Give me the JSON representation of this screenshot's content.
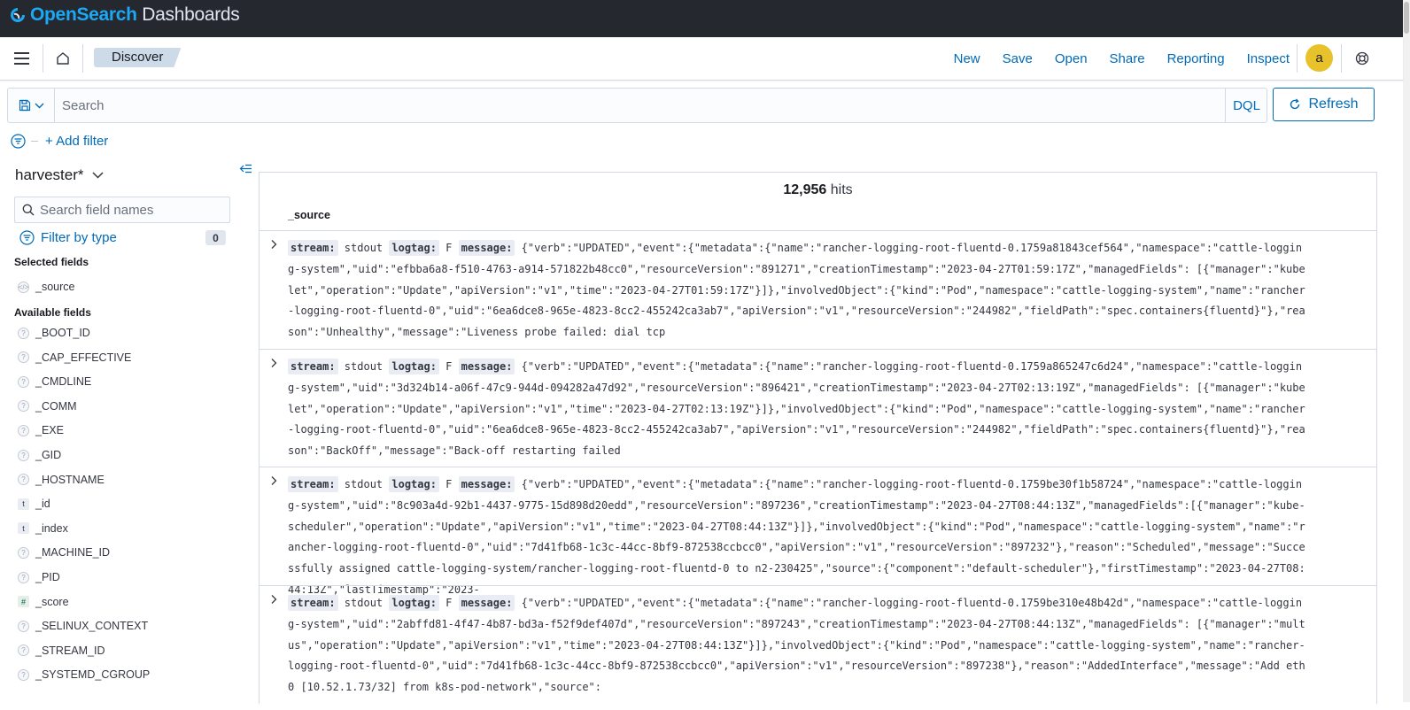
{
  "app": {
    "logo_brand": "OpenSearch",
    "logo_suffix": " Dashboards",
    "colors": {
      "brand": "#1ba9f5",
      "accent": "#006bb8",
      "topbar": "#25282f",
      "breadcrumb": "#cddbe8",
      "avatar": "#e7c22b"
    }
  },
  "nav": {
    "breadcrumb": "Discover",
    "links": [
      "New",
      "Save",
      "Open",
      "Share",
      "Reporting",
      "Inspect"
    ],
    "avatar_initial": "a"
  },
  "query": {
    "placeholder": "Search",
    "language": "DQL",
    "refresh_label": "Refresh"
  },
  "filters": {
    "add_label": "+ Add filter"
  },
  "sidebar": {
    "index_pattern": "harvester*",
    "field_search_placeholder": "Search field names",
    "filter_by_type": "Filter by type",
    "filter_count": "0",
    "selected_title": "Selected fields",
    "selected": [
      {
        "name": "_source",
        "type": "source"
      }
    ],
    "available_title": "Available fields",
    "available": [
      {
        "name": "_BOOT_ID",
        "type": "unknown"
      },
      {
        "name": "_CAP_EFFECTIVE",
        "type": "unknown"
      },
      {
        "name": "_CMDLINE",
        "type": "unknown"
      },
      {
        "name": "_COMM",
        "type": "unknown"
      },
      {
        "name": "_EXE",
        "type": "unknown"
      },
      {
        "name": "_GID",
        "type": "unknown"
      },
      {
        "name": "_HOSTNAME",
        "type": "unknown"
      },
      {
        "name": "_id",
        "type": "string"
      },
      {
        "name": "_index",
        "type": "string"
      },
      {
        "name": "_MACHINE_ID",
        "type": "unknown"
      },
      {
        "name": "_PID",
        "type": "unknown"
      },
      {
        "name": "_score",
        "type": "number"
      },
      {
        "name": "_SELINUX_CONTEXT",
        "type": "unknown"
      },
      {
        "name": "_STREAM_ID",
        "type": "unknown"
      },
      {
        "name": "_SYSTEMD_CGROUP",
        "type": "unknown"
      }
    ]
  },
  "results": {
    "hits_count": "12,956",
    "hits_label": " hits",
    "column": "_source",
    "rows": [
      {
        "stream_key": "stream:",
        "stream": " stdout ",
        "logtag_key": "logtag:",
        "logtag": " F ",
        "message_key": "message:",
        "message": " {\"verb\":\"UPDATED\",\"event\":{\"metadata\":{\"name\":\"rancher-logging-root-fluentd-0.1759a81843cef564\",\"namespace\":\"cattle-logging-system\",\"uid\":\"efbba6a8-f510-4763-a914-571822b48cc0\",\"resourceVersion\":\"891271\",\"creationTimestamp\":\"2023-04-27T01:59:17Z\",\"managedFields\": [{\"manager\":\"kubelet\",\"operation\":\"Update\",\"apiVersion\":\"v1\",\"time\":\"2023-04-27T01:59:17Z\"}]},\"involvedObject\":{\"kind\":\"Pod\",\"namespace\":\"cattle-logging-system\",\"name\":\"rancher-logging-root-fluentd-0\",\"uid\":\"6ea6dce8-965e-4823-8cc2-455242ca3ab7\",\"apiVersion\":\"v1\",\"resourceVersion\":\"244982\",\"fieldPath\":\"spec.containers{fluentd}\"},\"reason\":\"Unhealthy\",\"message\":\"Liveness probe failed: dial tcp"
      },
      {
        "stream_key": "stream:",
        "stream": " stdout ",
        "logtag_key": "logtag:",
        "logtag": " F ",
        "message_key": "message:",
        "message": " {\"verb\":\"UPDATED\",\"event\":{\"metadata\":{\"name\":\"rancher-logging-root-fluentd-0.1759a865247c6d24\",\"namespace\":\"cattle-logging-system\",\"uid\":\"3d324b14-a06f-47c9-944d-094282a47d92\",\"resourceVersion\":\"896421\",\"creationTimestamp\":\"2023-04-27T02:13:19Z\",\"managedFields\": [{\"manager\":\"kubelet\",\"operation\":\"Update\",\"apiVersion\":\"v1\",\"time\":\"2023-04-27T02:13:19Z\"}]},\"involvedObject\":{\"kind\":\"Pod\",\"namespace\":\"cattle-logging-system\",\"name\":\"rancher-logging-root-fluentd-0\",\"uid\":\"6ea6dce8-965e-4823-8cc2-455242ca3ab7\",\"apiVersion\":\"v1\",\"resourceVersion\":\"244982\",\"fieldPath\":\"spec.containers{fluentd}\"},\"reason\":\"BackOff\",\"message\":\"Back-off restarting failed"
      },
      {
        "stream_key": "stream:",
        "stream": " stdout ",
        "logtag_key": "logtag:",
        "logtag": " F ",
        "message_key": "message:",
        "message": " {\"verb\":\"UPDATED\",\"event\":{\"metadata\":{\"name\":\"rancher-logging-root-fluentd-0.1759be30f1b58724\",\"namespace\":\"cattle-logging-system\",\"uid\":\"8c903a4d-92b1-4437-9775-15d898d20edd\",\"resourceVersion\":\"897236\",\"creationTimestamp\":\"2023-04-27T08:44:13Z\",\"managedFields\":[{\"manager\":\"kube-scheduler\",\"operation\":\"Update\",\"apiVersion\":\"v1\",\"time\":\"2023-04-27T08:44:13Z\"}]},\"involvedObject\":{\"kind\":\"Pod\",\"namespace\":\"cattle-logging-system\",\"name\":\"rancher-logging-root-fluentd-0\",\"uid\":\"7d41fb68-1c3c-44cc-8bf9-872538ccbcc0\",\"apiVersion\":\"v1\",\"resourceVersion\":\"897232\"},\"reason\":\"Scheduled\",\"message\":\"Successfully assigned cattle-logging-system/rancher-logging-root-fluentd-0 to n2-230425\",\"source\":{\"component\":\"default-scheduler\"},\"firstTimestamp\":\"2023-04-27T08:44:13Z\",\"lastTimestamp\":\"2023-"
      },
      {
        "stream_key": "stream:",
        "stream": " stdout ",
        "logtag_key": "logtag:",
        "logtag": " F ",
        "message_key": "message:",
        "message": " {\"verb\":\"UPDATED\",\"event\":{\"metadata\":{\"name\":\"rancher-logging-root-fluentd-0.1759be310e48b42d\",\"namespace\":\"cattle-logging-system\",\"uid\":\"2abffd81-4f47-4b87-bd3a-f52f9def407d\",\"resourceVersion\":\"897243\",\"creationTimestamp\":\"2023-04-27T08:44:13Z\",\"managedFields\": [{\"manager\":\"multus\",\"operation\":\"Update\",\"apiVersion\":\"v1\",\"time\":\"2023-04-27T08:44:13Z\"}]},\"involvedObject\":{\"kind\":\"Pod\",\"namespace\":\"cattle-logging-system\",\"name\":\"rancher-logging-root-fluentd-0\",\"uid\":\"7d41fb68-1c3c-44cc-8bf9-872538ccbcc0\",\"apiVersion\":\"v1\",\"resourceVersion\":\"897238\"},\"reason\":\"AddedInterface\",\"message\":\"Add eth0 [10.52.1.73/32] from k8s-pod-network\",\"source\":"
      }
    ]
  }
}
